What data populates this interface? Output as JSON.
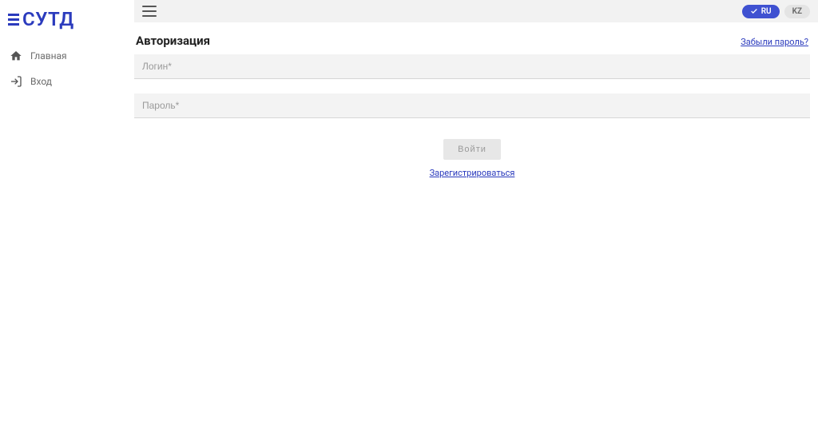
{
  "brand": {
    "logo_text": "СУТД"
  },
  "sidebar": {
    "items": [
      {
        "label": "Главная"
      },
      {
        "label": "Вход"
      }
    ]
  },
  "topbar": {
    "languages": {
      "ru": "RU",
      "kz": "KZ",
      "active": "ru"
    }
  },
  "auth": {
    "title": "Авторизация",
    "forgot_password": "Забыли пароль?",
    "login_placeholder": "Логин*",
    "password_placeholder": "Пароль*",
    "submit_label": "Войти",
    "register_label": "Зарегистрироваться"
  }
}
